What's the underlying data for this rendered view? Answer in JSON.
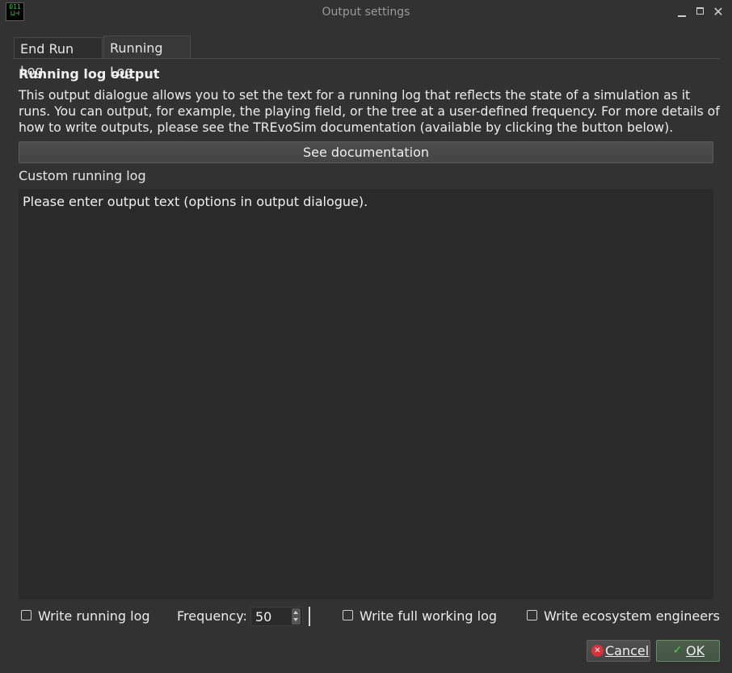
{
  "window": {
    "title": "Output settings",
    "icon_text_top": "011",
    "icon_text_bottom": "⊔⊣"
  },
  "tabs": [
    {
      "label": "End Run Log",
      "active": false
    },
    {
      "label": "Running Log",
      "active": true
    }
  ],
  "section": {
    "heading": "Running log output",
    "description": "This output dialogue allows you to set the text for a running log that reflects the state of a simulation as it runs. You can output, for example, the playing field, or the tree at a user-defined frequency. For more details of how to write outputs, please see the TREvoSim documentation (available by clicking the button below).",
    "doc_button_label": "See documentation",
    "custom_label": "Custom running log",
    "editor_text": "Please enter output text (options in output dialogue)."
  },
  "options": {
    "write_running_log": {
      "label": "Write running log",
      "checked": false
    },
    "frequency_label": "Frequency:",
    "frequency_value": "50",
    "write_full_working_log": {
      "label": "Write full working log",
      "checked": false
    },
    "write_ecosystem_engineers": {
      "label": "Write ecosystem engineers",
      "checked": false
    }
  },
  "buttons": {
    "cancel_label": "Cancel",
    "ok_label": "OK"
  },
  "colors": {
    "background": "#323232",
    "editor_background": "#2a2a2a",
    "ok_check": "#3ddc3d",
    "cancel_icon": "#d8323a"
  }
}
